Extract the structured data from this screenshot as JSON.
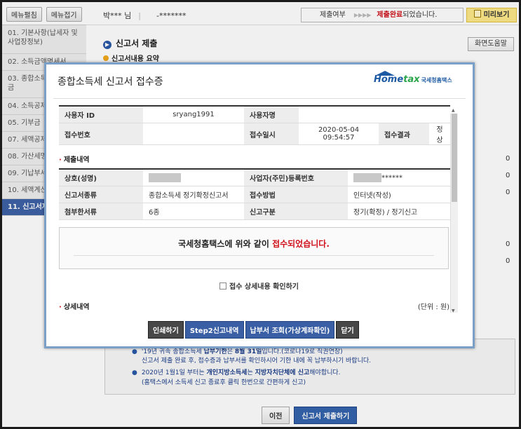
{
  "sidebar": {
    "top_buttons": [
      "메뉴펼침",
      "메뉴접기"
    ],
    "items": [
      {
        "label": "01. 기본사항(납세자 및\n사업장정보)"
      },
      {
        "label": "02. 소득금액명세서"
      },
      {
        "label": "03. 종합소득\n금"
      },
      {
        "label": "04. 소득공제"
      },
      {
        "label": "05. 기부금"
      },
      {
        "label": "07. 세액공제"
      },
      {
        "label": "08. 가산세명"
      },
      {
        "label": "09. 기납부세"
      },
      {
        "label": "10. 세액계산"
      },
      {
        "label": "11. 신고서제"
      }
    ]
  },
  "topbar": {
    "user_name": "박*** 님",
    "user_id": "-*******",
    "status_label": "제출여부",
    "status_arrows": "▶▶▶▶",
    "status_done": "제출완료",
    "status_suffix": "되었습니다.",
    "preview": "미리보기"
  },
  "main": {
    "title": "신고서 제출",
    "subtitle": "신고서내용 요약",
    "help": "화면도움말",
    "zeros": [
      "0",
      "0",
      "0",
      "0",
      "0"
    ]
  },
  "modal": {
    "title": "종합소득세 신고서 접수증",
    "logo_main": "Home",
    "logo_accent": "tax",
    "logo_sub": "국세청홈택스",
    "rows": [
      {
        "h1": "사용자 ID",
        "v1": "sryang1991",
        "h2": "사용자명",
        "v2": "",
        "h3": "",
        "v3": ""
      },
      {
        "h1": "접수번호",
        "v1": "",
        "h2": "접수일시",
        "v2": "2020-05-04 09:54:57",
        "h3": "접수결과",
        "v3": "정상"
      }
    ],
    "section1": "제출내역",
    "rows2": [
      {
        "h1": "상호(성명)",
        "v1": "",
        "h2": "사업자(주민)등록번호",
        "v2": "******"
      },
      {
        "h1": "신고서종류",
        "v1": "종합소득세 정기확정신고서",
        "h2": "접수방법",
        "v2": "인터넷(작성)"
      },
      {
        "h1": "첨부한서류",
        "v1": "6종",
        "h2": "신고구분",
        "v2": "정기(확정) / 정기신고"
      }
    ],
    "msg_prefix": "국세청홈택스에 위와 같이 ",
    "msg_red": "접수되었습니다.",
    "check_label": "접수 상세내용 확인하기",
    "section2": "상세내역",
    "unit": "(단위 : 원)",
    "buttons": [
      "인쇄하기",
      "Step2신고내역",
      "납부서 조회(가상계좌확인)",
      "닫기"
    ]
  },
  "notice": {
    "l1_pre": "'19년 귀속 종합소득세 ",
    "l1_b1": "납부기한",
    "l1_mid": "은 ",
    "l1_b2": "8월 31일",
    "l1_post": "입니다.(코로나19로 직권연장)",
    "l2": "신고서 제출 완료 후, 접수증과 납부서를 확인하시어 기한 내에 꼭 납부하시기 바랍니다.",
    "l3_pre": "2020년 1월1일 부터는 ",
    "l3_b1": "개인지방소득세",
    "l3_mid": "는 ",
    "l3_b2": "지방자치단체에 신고",
    "l3_post": "해야합니다.",
    "l4": "(홈택스에서 소득세 신고 종료후 클릭 한번으로 간편하게 신고)"
  },
  "bottom": {
    "prev": "이전",
    "submit": "신고서 제출하기"
  }
}
